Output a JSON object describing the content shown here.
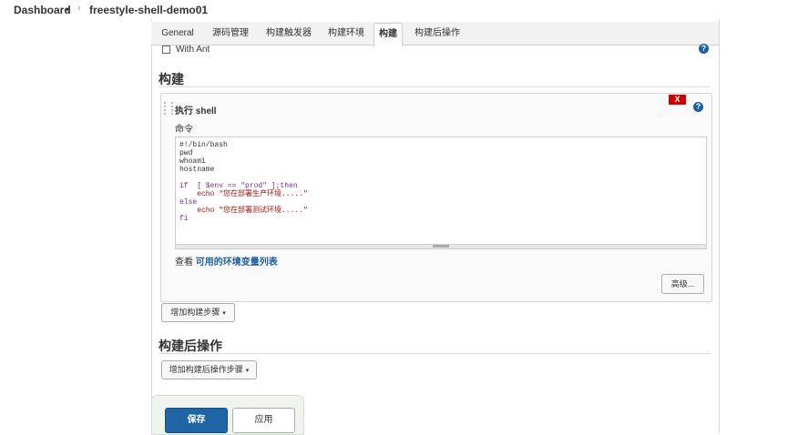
{
  "breadcrumb": {
    "dashboard": "Dashboard",
    "dashboard_caret": "▾",
    "separator": "›",
    "job": "freestyle-shell-demo01",
    "job_caret": "›"
  },
  "tabs": [
    {
      "label": "General"
    },
    {
      "label": "源码管理"
    },
    {
      "label": "构建触发器"
    },
    {
      "label": "构建环境"
    },
    {
      "label": "构建"
    },
    {
      "label": "构建后操作"
    }
  ],
  "build_env": {
    "with_ant_label": "With Ant",
    "with_ant_checked": false
  },
  "build": {
    "section_title": "构建",
    "step": {
      "title": "执行 shell",
      "delete_label": "X",
      "command_label": "命令",
      "command_lines": [
        "#!/bin/bash",
        "pwd",
        "whoami",
        "hostname",
        "",
        "if  [ $env == \"prod\" ];then",
        "    echo \"您在部署生产环境.....\"",
        "else",
        "    echo \"您在部署测试环境.....\"",
        "fi"
      ],
      "env_prefix": "查看",
      "env_link": "可用的环境变量列表",
      "advanced_label": "高级..."
    },
    "add_step_label": "增加构建步骤",
    "add_step_caret": "▾"
  },
  "post_build": {
    "section_title": "构建后操作",
    "add_step_label": "增加构建后操作步骤",
    "add_step_caret": "▾"
  },
  "footer": {
    "save_label": "保存",
    "apply_label": "应用"
  },
  "help_icon_glyph": "?",
  "colors": {
    "primary": "#1f64a5",
    "delete": "#cc0000",
    "link": "#1d5f9e"
  }
}
